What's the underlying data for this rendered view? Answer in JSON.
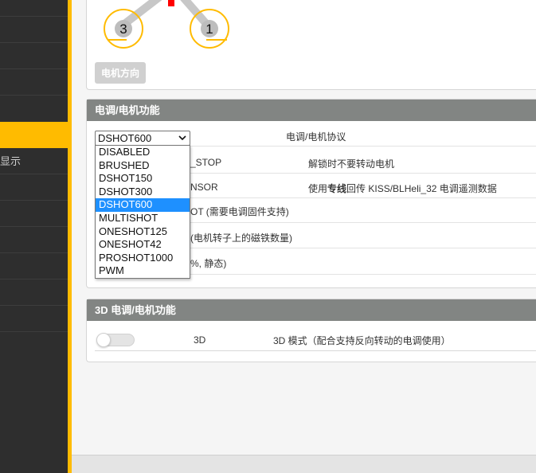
{
  "sidebar": {
    "items": [
      {
        "label": ""
      },
      {
        "label": ""
      },
      {
        "label": ""
      },
      {
        "label": ""
      },
      {
        "label": ""
      },
      {
        "label": "显示"
      },
      {
        "label": ""
      },
      {
        "label": ""
      },
      {
        "label": ""
      },
      {
        "label": ""
      },
      {
        "label": ""
      },
      {
        "label": ""
      }
    ],
    "active_index": 4
  },
  "motor_panel": {
    "motor_labels": [
      "3",
      "1"
    ],
    "direction_button": "电机方向"
  },
  "esc_panel": {
    "title": "电调/电机功能",
    "protocol_value": "DSHOT600",
    "protocol_label": "电调/电机协议",
    "protocol_options": [
      "DISABLED",
      "BRUSHED",
      "DSHOT150",
      "DSHOT300",
      "DSHOT600",
      "MULTISHOT",
      "ONESHOT125",
      "ONESHOT42",
      "PROSHOT1000",
      "PWM"
    ],
    "selected_option": "DSHOT600",
    "rows": [
      {
        "name": "_STOP",
        "description": "解锁时不要转动电机"
      },
      {
        "name": "NSOR",
        "description_prefix": "使用",
        "description_bold": "专线",
        "description_suffix": "回传 KISS/BLHeli_32 电调遥测数据"
      },
      {
        "name": "OT (需要电调固件支持)"
      },
      {
        "name": "(电机转子上的磁铁数量)"
      },
      {
        "name": "%, 静态)"
      }
    ]
  },
  "panel_3d": {
    "title": "3D 电调/电机功能",
    "toggle_label": "3D",
    "toggle_on": false,
    "description": "3D 模式（配合支持反向转动的电调使用）"
  },
  "colors": {
    "accent": "#ffbb00",
    "sidebar_bg": "#2e2e2e",
    "panel_header": "#828583",
    "motor_circle": "#ffbb00",
    "selected_option": "#1e90ff"
  }
}
